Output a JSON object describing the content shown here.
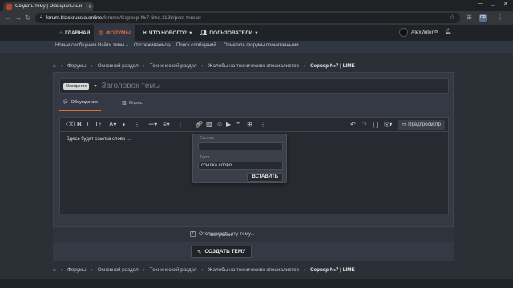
{
  "browser": {
    "tab_title": "Создать тему | Официальный ф",
    "tab_close": "✕",
    "new_tab": "+",
    "url_host": "forum.blackrussia.online",
    "url_path": "/forums/Сервер-№7-lime.1188/post-thread",
    "profile_initials": "OR"
  },
  "nav": {
    "home": "ГЛАВНАЯ",
    "forums": "ФОРУМЫ",
    "whats_new": "ЧТО НОВОГО?",
    "users": "ПОЛЬЗОВАТЕЛИ",
    "username": "AlexWiter"
  },
  "subnav": {
    "items": [
      "Новые сообщения",
      "Найти темы",
      "Отслеживаемое",
      "Поиск сообщений",
      "Отметить форумы прочитанными"
    ]
  },
  "breadcrumb": [
    "Форумы",
    "Основной раздел",
    "Технический раздел",
    "Жалобы на технических специалистов",
    "Сервер №7 | LIME"
  ],
  "thread": {
    "prefix": "Ожидание",
    "title_placeholder": "Заголовок темы"
  },
  "tabs": [
    "Обсуждение",
    "Опрос"
  ],
  "editor": {
    "preview_label": "Предпросмотр",
    "body_text": "Здесь будет ссылка слово ..."
  },
  "link_popup": {
    "url_label": "Ссылка",
    "url_value": "",
    "text_label": "Текст",
    "text_value": "ссылка слово",
    "insert_label": "ВСТАВИТЬ"
  },
  "settings": {
    "label": "Настройки:",
    "watch_label": "Отслеживать эту тему..."
  },
  "submit_label": "СОЗДАТЬ ТЕМУ",
  "colors": {
    "accent": "#e36b35",
    "page_bg": "#2b2f36",
    "panel_bg": "#343943",
    "input_bg": "#272a30"
  }
}
